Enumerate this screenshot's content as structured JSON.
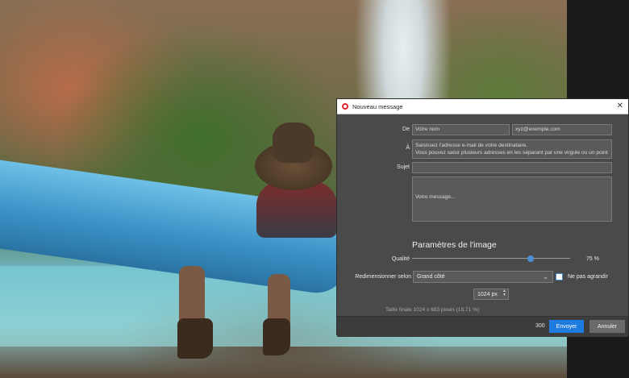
{
  "dialog": {
    "title": "Nouveau message",
    "close_glyph": "✕",
    "from_label": "De",
    "name_placeholder": "Votre nom",
    "email_placeholder": "xyz@exemple.com",
    "to_label": "À",
    "to_placeholder": "Saisissez l'adresse e-mail de votre destinataire.\nVous pouvez saisir plusieurs adresses en les séparant par une virgule ou un point",
    "subject_label": "Sujet",
    "subject_value": "",
    "message_placeholder": "Votre message...",
    "image_settings_title": "Paramètres de l'image",
    "quality_label": "Qualité",
    "quality_value": 75,
    "quality_text": "75 %",
    "resize_label": "Redimensionner selon",
    "resize_selected": "Grand côté",
    "no_enlarge_label": "Ne pas agrandir",
    "no_enlarge_checked": false,
    "size_value": "1024 px",
    "final_size_text": "Taille finale 1024 x 683 pixels (18,71 %)",
    "char_count": "300",
    "send_label": "Envoyer",
    "cancel_label": "Annuler"
  },
  "colors": {
    "accent": "#1e7be0",
    "dialog_bg": "#4a4a4a",
    "app_icon": "#e0282c"
  }
}
